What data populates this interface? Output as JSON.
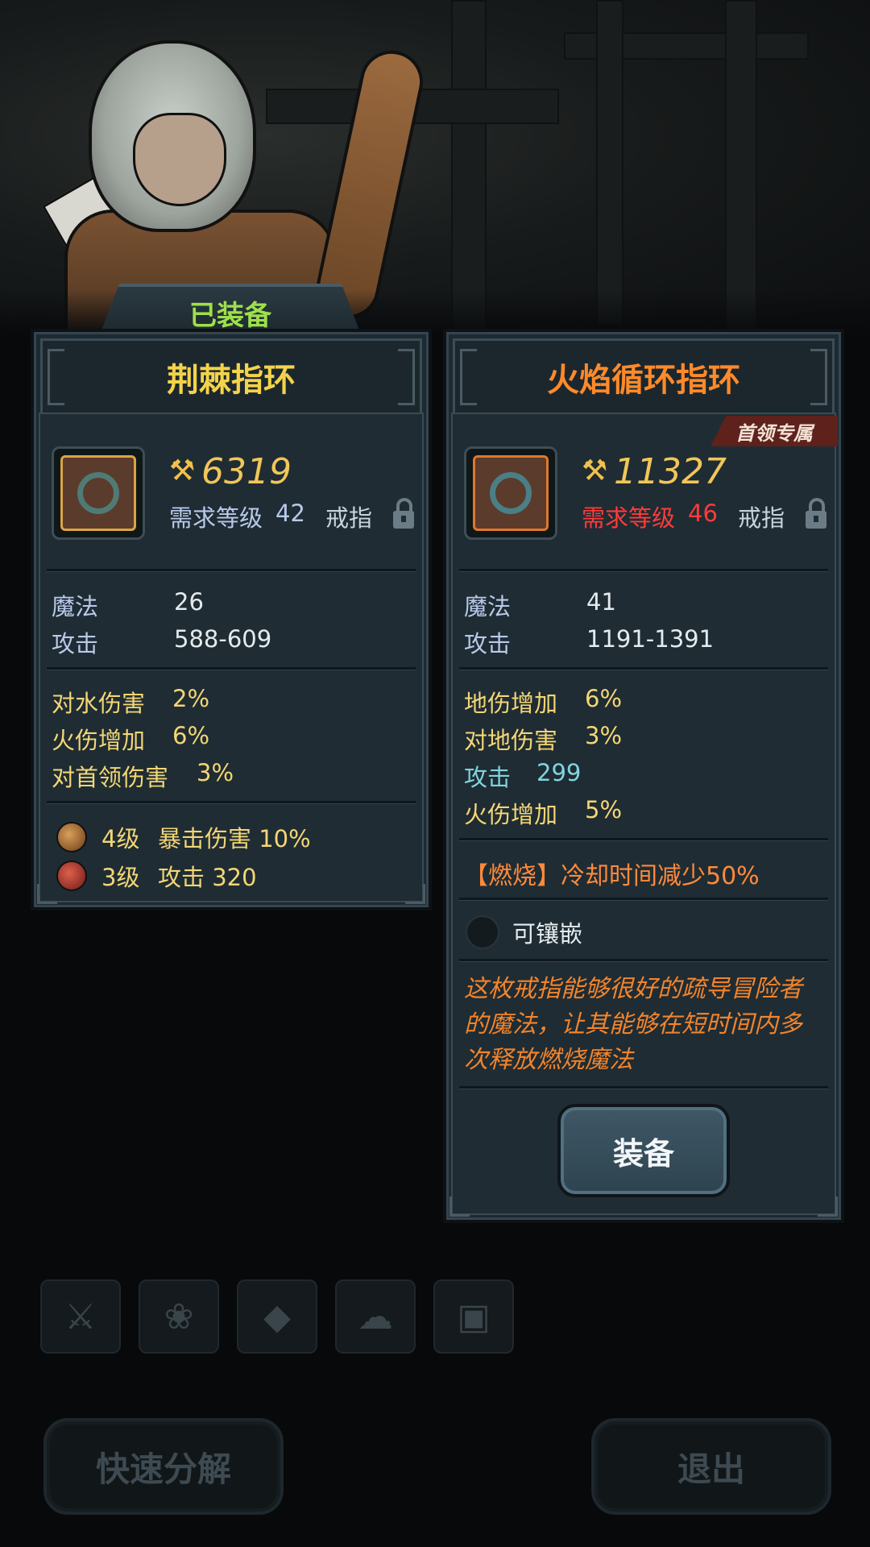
{
  "left_card": {
    "tab": "已装备",
    "name": "荆棘指环",
    "power": "6319",
    "req_prefix": "需求等级",
    "req_level": "42",
    "slot": "戒指",
    "stats": [
      {
        "k": "魔法",
        "v": "26"
      },
      {
        "k": "攻击",
        "v": "588-609"
      }
    ],
    "affixes": [
      {
        "k": "对水伤害",
        "v": "2%"
      },
      {
        "k": "火伤增加",
        "v": "6%"
      },
      {
        "k": "对首领伤害",
        "v": "3%"
      }
    ],
    "gems": [
      {
        "level": "4级",
        "text": "暴击伤害 10%"
      },
      {
        "level": "3级",
        "text": "攻击 320"
      }
    ]
  },
  "right_card": {
    "name": "火焰循环指环",
    "tag": "首领专属",
    "power": "11327",
    "req_prefix": "需求等级",
    "req_level": "46",
    "slot": "戒指",
    "stats": [
      {
        "k": "魔法",
        "v": "41"
      },
      {
        "k": "攻击",
        "v": "1191-1391"
      }
    ],
    "affixes": [
      {
        "k": "地伤增加",
        "v": "6%"
      },
      {
        "k": "对地伤害",
        "v": "3%"
      },
      {
        "k": "攻击",
        "v": "299"
      },
      {
        "k": "火伤增加",
        "v": "5%"
      }
    ],
    "special": "【燃烧】冷却时间减少50%",
    "socket": "可镶嵌",
    "description": "这枚戒指能够很好的疏导冒险者的魔法，让其能够在短时间内多次释放燃烧魔法",
    "equip_button": "装备"
  },
  "bottom": {
    "quick_dismantle": "快速分解",
    "exit": "退出"
  },
  "colors": {
    "equipped_green": "#9ee04a",
    "old_name": "#f3d34a",
    "new_name": "#ff8a2a",
    "req_fail": "#ff3b3b"
  }
}
